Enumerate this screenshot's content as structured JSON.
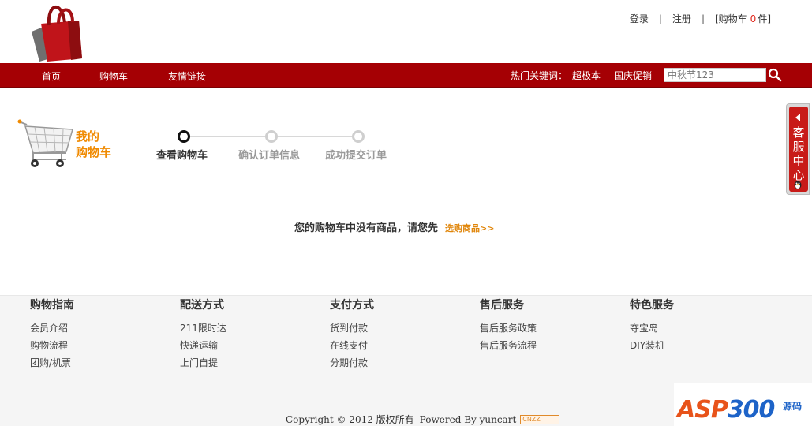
{
  "header": {
    "login": "登录",
    "separator": "|",
    "register": "注册",
    "cart_prefix": "[购物车",
    "cart_count": "0",
    "cart_suffix": "件]"
  },
  "nav": {
    "items": [
      "首页",
      "购物车",
      "友情链接"
    ],
    "hot_label": "热门关键词：",
    "hot_keywords": [
      "超极本",
      "国庆促销"
    ],
    "search_placeholder": "中秋节123"
  },
  "cart": {
    "title_line1": "我的",
    "title_line2": "购物车",
    "steps": [
      {
        "label": "查看购物车",
        "state": "active"
      },
      {
        "label": "确认订单信息",
        "state": "inactive"
      },
      {
        "label": "成功提交订单",
        "state": "inactive"
      }
    ],
    "empty_message": "您的购物车中没有商品，请您先",
    "shop_link": "选购商品>>"
  },
  "customer_service": {
    "label": "客服中心"
  },
  "footer": {
    "columns": [
      {
        "title": "购物指南",
        "links": [
          "会员介绍",
          "购物流程",
          "团购/机票"
        ]
      },
      {
        "title": "配送方式",
        "links": [
          "211限时达",
          "快递运输",
          "上门自提"
        ]
      },
      {
        "title": "支付方式",
        "links": [
          "货到付款",
          "在线支付",
          "分期付款"
        ]
      },
      {
        "title": "售后服务",
        "links": [
          "售后服务政策",
          "售后服务流程"
        ]
      },
      {
        "title": "特色服务",
        "links": [
          "夺宝岛",
          "DIY装机"
        ]
      }
    ],
    "copyright": "Copyright © 2012 版权所有",
    "powered_by": "Powered By yuncart",
    "cnzz_badge": "CNZZ"
  },
  "watermark": {
    "text_a": "ASP",
    "text_b": "300",
    "side": "源码"
  },
  "colors": {
    "brand_red": "#a50004",
    "accent_orange": "#f08a00",
    "count_red": "#e0261a"
  }
}
